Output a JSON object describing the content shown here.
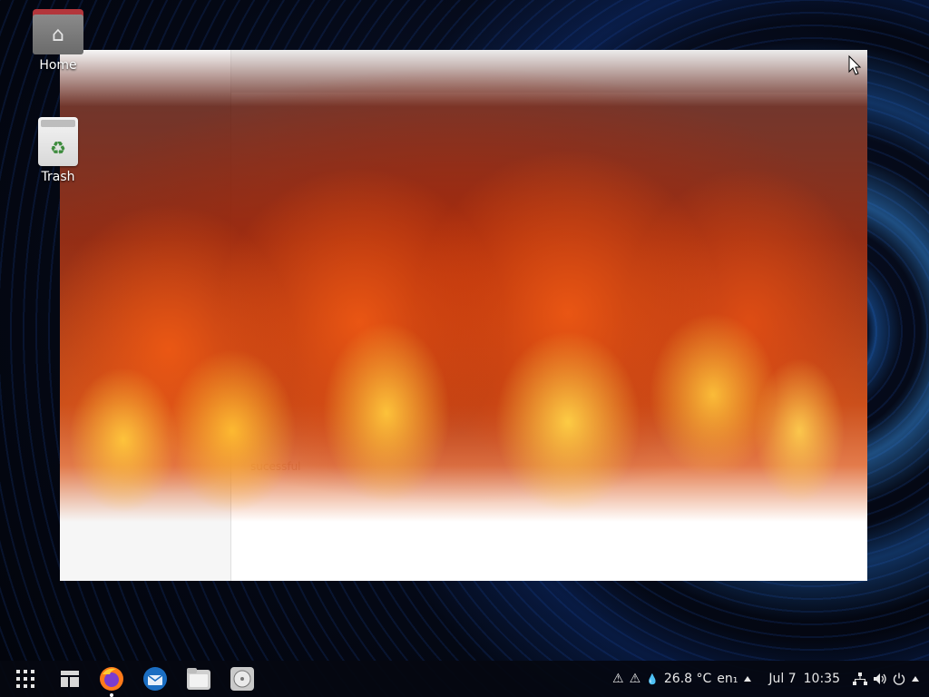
{
  "desktop": {
    "icons": [
      {
        "label": "Home",
        "icon": "home-folder-icon"
      },
      {
        "label": "Trash",
        "icon": "trash-icon"
      }
    ]
  },
  "window": {
    "faint_text": "sucessful"
  },
  "taskbar": {
    "launchers": [
      {
        "name": "apps-grid",
        "icon": "grid-icon"
      },
      {
        "name": "windows-overview",
        "icon": "windows-icon"
      },
      {
        "name": "Firefox",
        "icon": "firefox-icon",
        "active": true
      },
      {
        "name": "Thunderbird",
        "icon": "thunderbird-icon"
      },
      {
        "name": "Files",
        "icon": "files-icon"
      },
      {
        "name": "Disks",
        "icon": "disks-icon"
      }
    ],
    "tray": {
      "warning1": "⚠",
      "warning2": "⚠",
      "weather_icon": "💧",
      "temperature": "26.8 °C",
      "keyboard": "en₁",
      "date": "Jul 7",
      "time": "10:35"
    }
  },
  "colors": {
    "folder_tab": "#b3363b",
    "taskbar_bg": "#05080f",
    "wallpaper_accent": "#2a8cff"
  }
}
